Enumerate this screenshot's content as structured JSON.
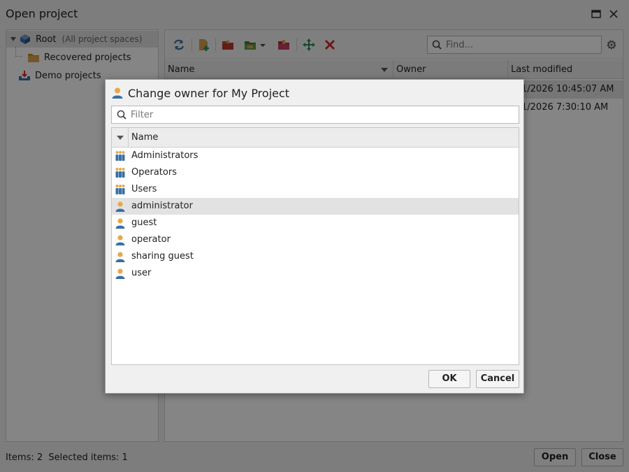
{
  "window": {
    "title": "Open project"
  },
  "tree": {
    "items": [
      {
        "label": "Root",
        "sublabel": "(All project spaces)"
      },
      {
        "label": "Recovered projects"
      },
      {
        "label": "Demo projects"
      }
    ]
  },
  "search": {
    "placeholder": "Find..."
  },
  "grid": {
    "columns": [
      "Name",
      "Owner",
      "Last modified"
    ],
    "rows": [
      {
        "last_modified": "1/2026 10:45:07 AM"
      },
      {
        "last_modified": "1/2026 7:30:10 AM"
      }
    ]
  },
  "status": {
    "text": "Items: 2  Selected items: 1"
  },
  "buttons": {
    "open": "Open",
    "close": "Close"
  },
  "dialog": {
    "title": "Change owner for My Project",
    "filter_placeholder": "Filter",
    "column_name": "Name",
    "items": [
      {
        "name": "Administrators",
        "icon": "group-icon"
      },
      {
        "name": "Operators",
        "icon": "group-icon"
      },
      {
        "name": "Users",
        "icon": "group-icon"
      },
      {
        "name": "administrator",
        "icon": "user-icon"
      },
      {
        "name": "guest",
        "icon": "user-icon"
      },
      {
        "name": "operator",
        "icon": "user-icon"
      },
      {
        "name": "sharing guest",
        "icon": "user-icon"
      },
      {
        "name": "user",
        "icon": "user-icon"
      }
    ],
    "ok": "OK",
    "cancel": "Cancel"
  },
  "colors": {
    "accent_blue": "#3a6fa6",
    "user_head": "#e8a84a",
    "delete_red": "#d02a2a",
    "move_green": "#2e8b57"
  }
}
